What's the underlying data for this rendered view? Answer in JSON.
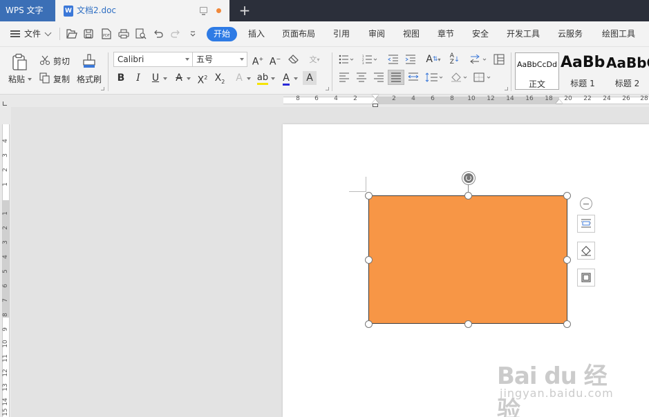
{
  "titlebar": {
    "app_name": "WPS 文字",
    "doc_title": "文档2.doc",
    "doc_icon": "W",
    "new_tab_symbol": "+"
  },
  "menubar": {
    "file_label": "文件",
    "active_tab": "开始",
    "tabs": [
      "插入",
      "页面布局",
      "引用",
      "审阅",
      "视图",
      "章节",
      "安全",
      "开发工具",
      "云服务",
      "绘图工具"
    ]
  },
  "toolbar": {
    "paste_label": "粘贴",
    "cut_label": "剪切",
    "copy_label": "复制",
    "format_painter_label": "格式刷",
    "font_family": "Calibri",
    "font_size": "五号",
    "styles": [
      {
        "sample": "AaBbCcDd",
        "name": "正文"
      },
      {
        "sample": "AaBb",
        "name": "标题 1"
      },
      {
        "sample": "AaBbC",
        "name": "标题 2"
      }
    ]
  },
  "ruler": {
    "horizontal_ticks": [
      "8",
      "6",
      "4",
      "2",
      "2",
      "4",
      "6",
      "8",
      "10",
      "12",
      "14",
      "16",
      "18",
      "20",
      "22",
      "24",
      "26",
      "28"
    ],
    "vertical_ticks": [
      "4",
      "3",
      "2",
      "1",
      "1",
      "2",
      "3",
      "4",
      "5",
      "6",
      "7",
      "8",
      "9",
      "10",
      "11",
      "12",
      "13",
      "14",
      "15"
    ]
  },
  "shape": {
    "fill_color": "#f79646"
  },
  "watermark": {
    "logo_text": "Bai du 经验",
    "url_text": "jingyan.baidu.com"
  },
  "colors": {
    "accent": "#2e7be5",
    "titlebar_bg": "#2b2f3a",
    "app_tab_bg": "#3b6fb6"
  }
}
